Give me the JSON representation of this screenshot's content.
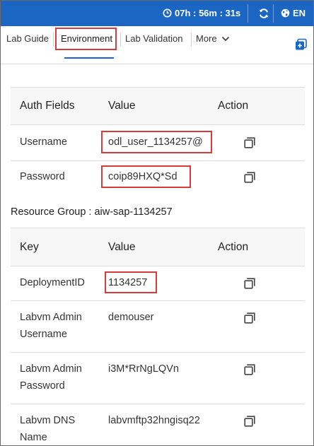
{
  "header": {
    "timer": "07h : 56m : 31s",
    "language": "EN"
  },
  "tabs": [
    {
      "label": "Lab Guide"
    },
    {
      "label": "Environment"
    },
    {
      "label": "Lab Validation"
    },
    {
      "label": "More"
    }
  ],
  "auth_table": {
    "columns": [
      "Auth Fields",
      "Value",
      "Action"
    ],
    "rows": [
      {
        "field": "Username",
        "value": "odl_user_1134257@"
      },
      {
        "field": "Password",
        "value": "coip89HXQ*Sd"
      }
    ]
  },
  "resource_group": {
    "title": "Resource Group : aiw-sap-1134257",
    "columns": [
      "Key",
      "Value",
      "Action"
    ],
    "rows": [
      {
        "key_line1": "DeploymentID",
        "key_line2": "",
        "value": "1134257"
      },
      {
        "key_line1": "Labvm Admin",
        "key_line2": "Username",
        "value": "demouser"
      },
      {
        "key_line1": "Labvm Admin",
        "key_line2": "Password",
        "value": "i3M*RrNgLQVn"
      },
      {
        "key_line1": "Labvm DNS",
        "key_line2": "Name",
        "value": "labvmftp32hngisq22"
      }
    ]
  },
  "colors": {
    "topbar": "#1a66c2",
    "highlight": "#d83b3b"
  }
}
